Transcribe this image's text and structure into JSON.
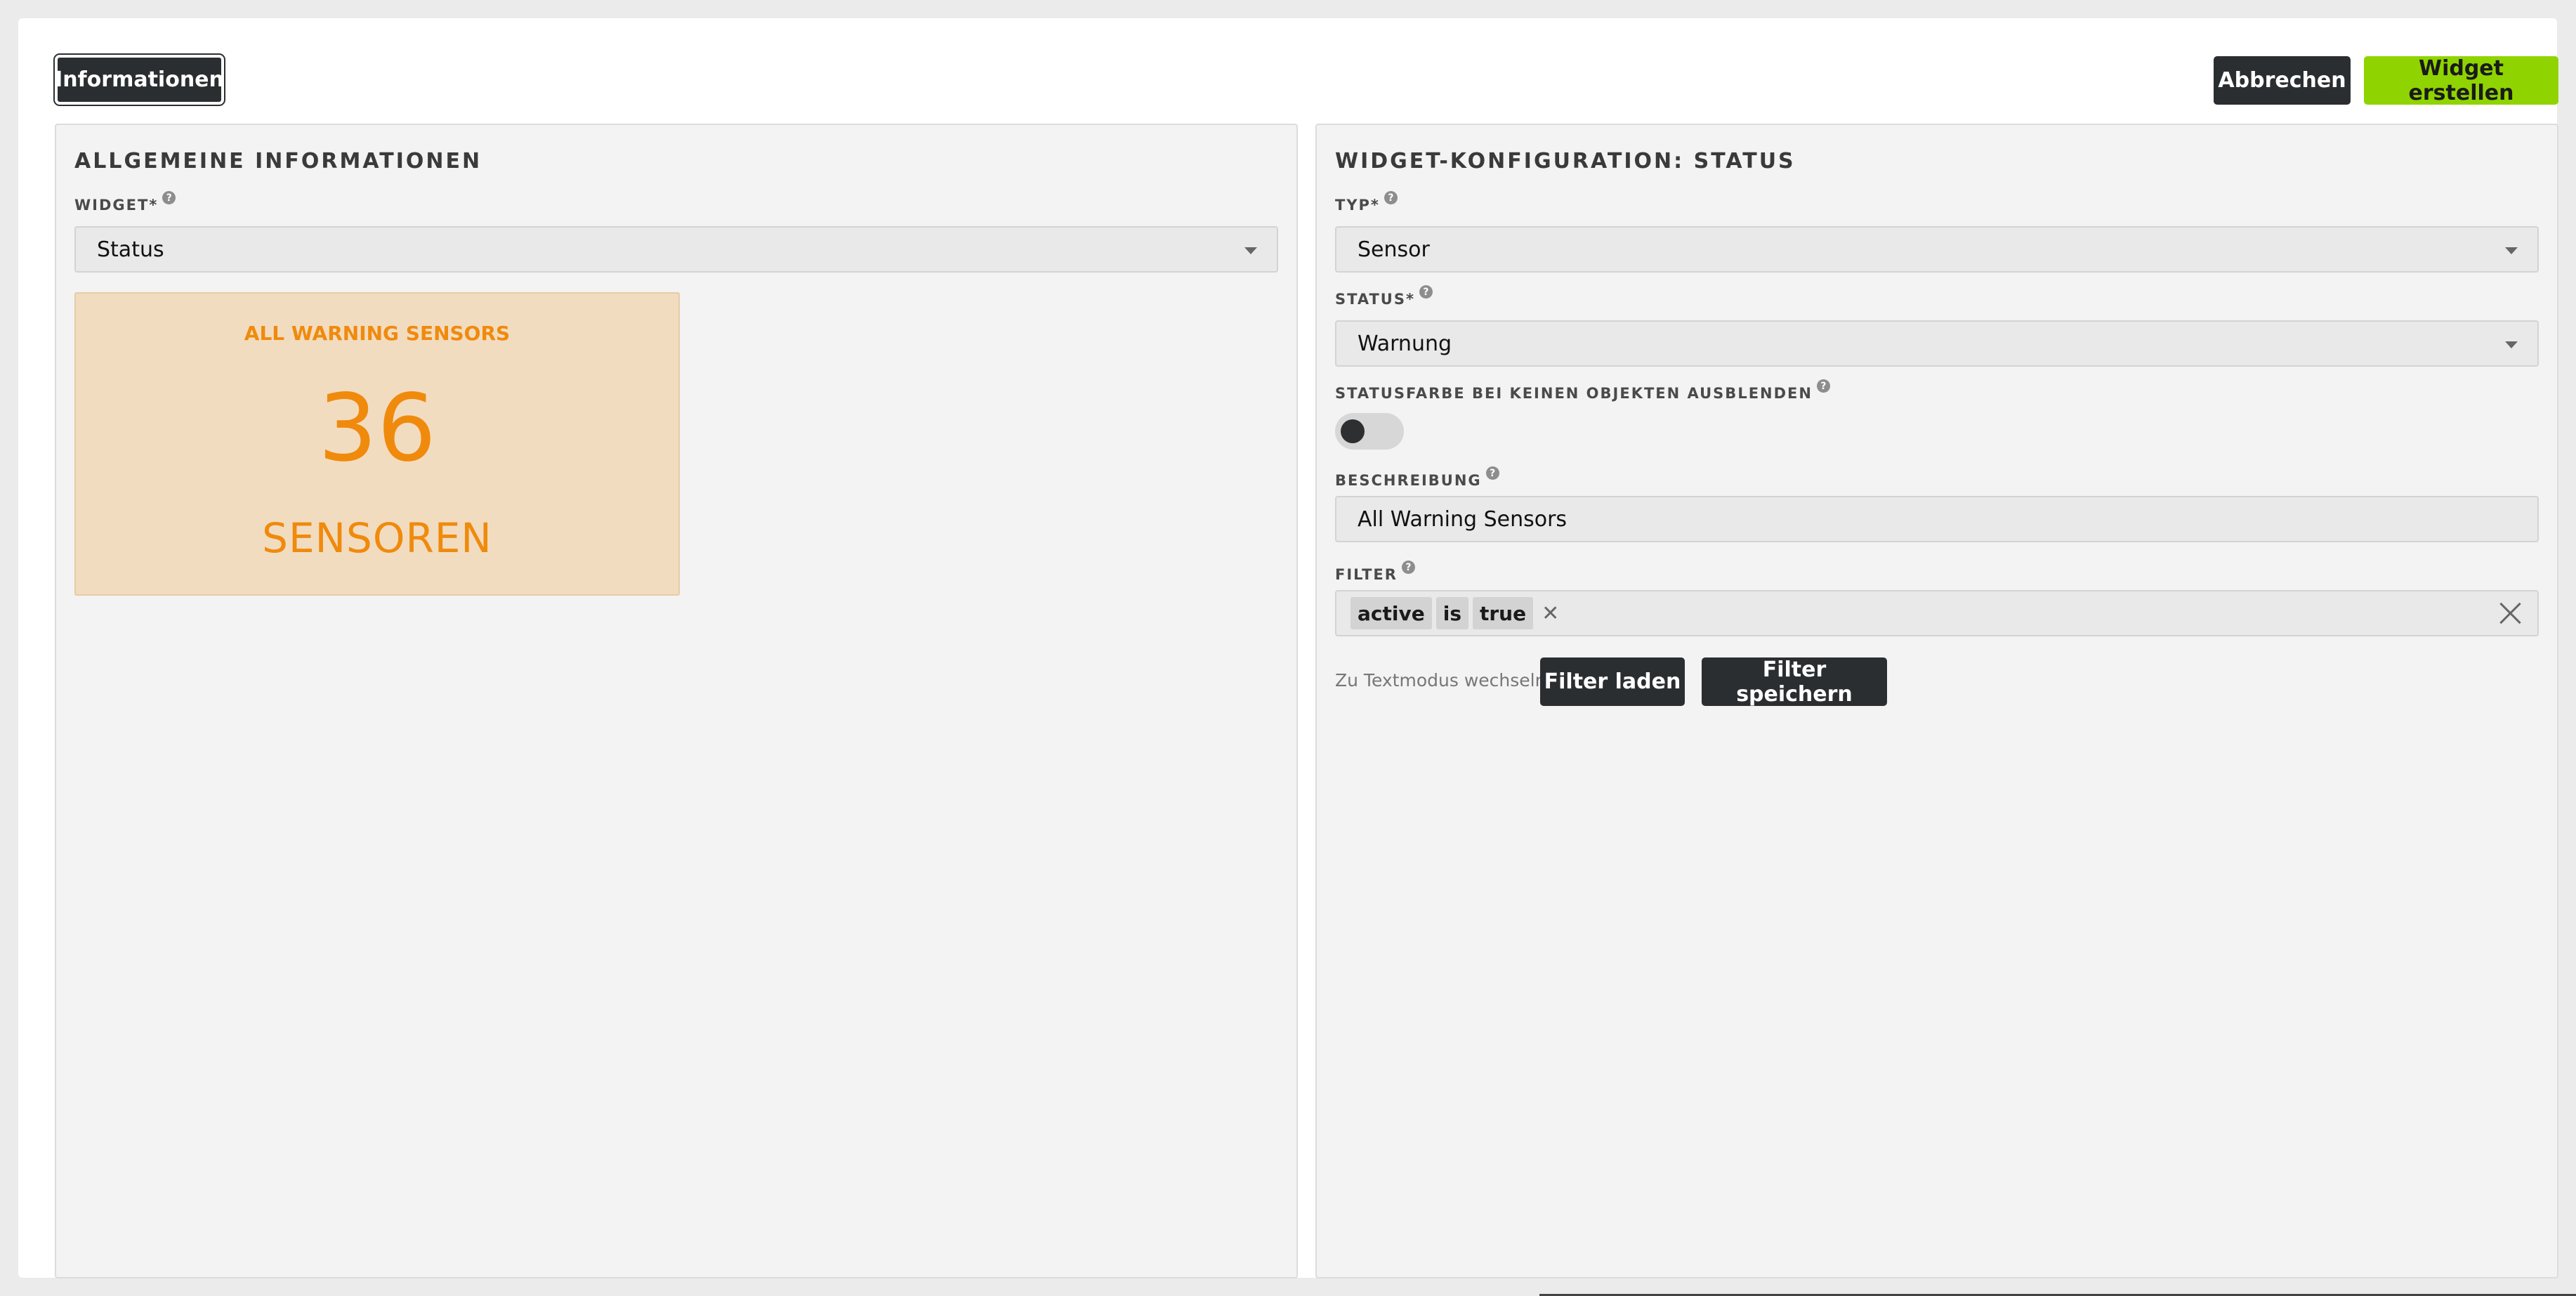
{
  "toolbar": {
    "info_button": "Informationen",
    "cancel_button": "Abbrechen",
    "create_button": "Widget erstellen"
  },
  "left_panel": {
    "title": "ALLGEMEINE INFORMATIONEN",
    "widget_label": "WIDGET*",
    "widget_value": "Status",
    "preview": {
      "title": "ALL WARNING SENSORS",
      "count": "36",
      "unit": "SENSOREN",
      "background_color": "#f2dcc0",
      "text_color": "#f08a0c"
    }
  },
  "right_panel": {
    "title": "WIDGET-KONFIGURATION: STATUS",
    "type_label": "TYP*",
    "type_value": "Sensor",
    "status_label": "STATUS*",
    "status_value": "Warnung",
    "hide_color_label": "STATUSFARBE BEI KEINEN OBJEKTEN AUSBLENDEN",
    "hide_color_enabled": false,
    "description_label": "BESCHREIBUNG",
    "description_value": "All Warning Sensors",
    "filter_label": "FILTER",
    "filter_chips": [
      "active",
      "is",
      "true"
    ],
    "textmode_link": "Zu Textmodus wechseln",
    "load_filter_button": "Filter laden",
    "save_filter_button": "Filter speichern"
  },
  "colors": {
    "accent_green": "#8fd400",
    "dark_button": "#2b2e31"
  }
}
